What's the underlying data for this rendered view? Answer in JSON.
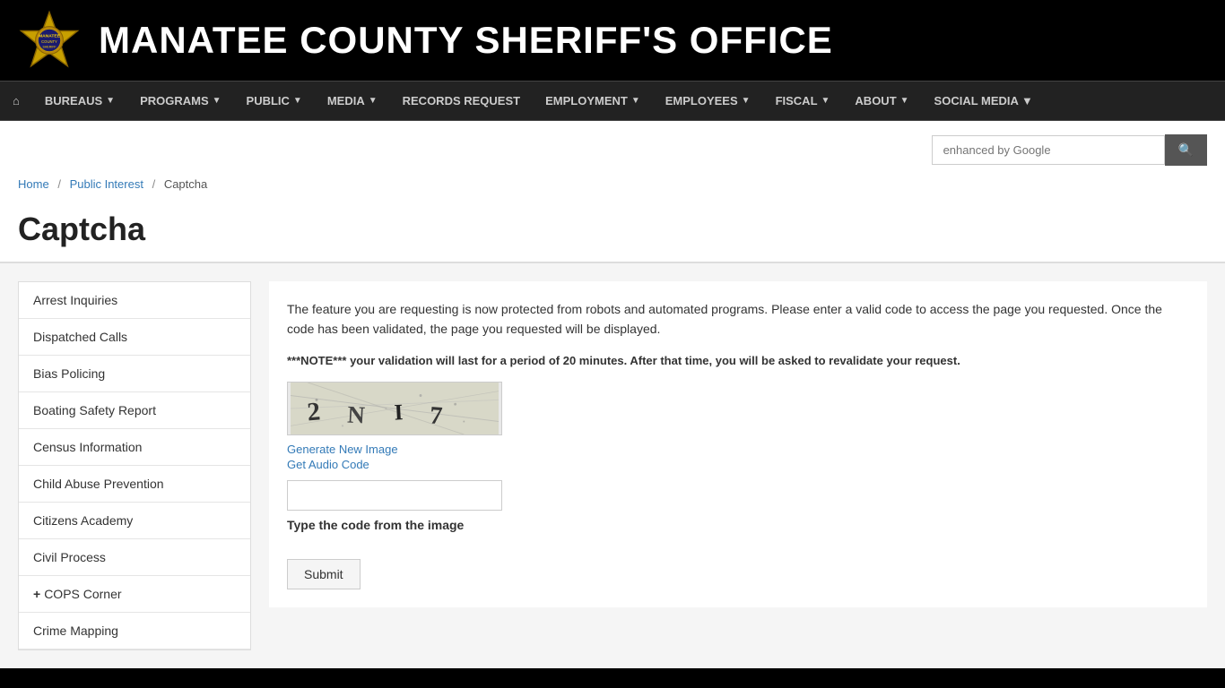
{
  "header": {
    "title": "MANATEE COUNTY SHERIFF'S OFFICE",
    "logo_alt": "Sheriff Badge"
  },
  "nav": {
    "home_label": "🏠",
    "items": [
      {
        "label": "BUREAUS",
        "has_dropdown": true
      },
      {
        "label": "PROGRAMS",
        "has_dropdown": true
      },
      {
        "label": "PUBLIC",
        "has_dropdown": true
      },
      {
        "label": "MEDIA",
        "has_dropdown": true
      },
      {
        "label": "RECORDS REQUEST",
        "has_dropdown": false
      },
      {
        "label": "EMPLOYMENT",
        "has_dropdown": true
      },
      {
        "label": "EMPLOYEES",
        "has_dropdown": true
      },
      {
        "label": "FISCAL",
        "has_dropdown": true
      },
      {
        "label": "ABOUT",
        "has_dropdown": true
      },
      {
        "label": "Social Media ▼",
        "has_dropdown": false
      }
    ]
  },
  "search": {
    "placeholder": "enhanced by Google",
    "button_label": "🔍"
  },
  "breadcrumb": {
    "home": "Home",
    "section": "Public Interest",
    "current": "Captcha"
  },
  "page": {
    "title": "Captcha"
  },
  "sidebar": {
    "items": [
      {
        "label": "Arrest Inquiries",
        "prefix": ""
      },
      {
        "label": "Dispatched Calls",
        "prefix": ""
      },
      {
        "label": "Bias Policing",
        "prefix": ""
      },
      {
        "label": "Boating Safety Report",
        "prefix": ""
      },
      {
        "label": "Census Information",
        "prefix": ""
      },
      {
        "label": "Child Abuse Prevention",
        "prefix": ""
      },
      {
        "label": "Citizens Academy",
        "prefix": ""
      },
      {
        "label": "Civil Process",
        "prefix": ""
      },
      {
        "label": "COPS Corner",
        "prefix": "+"
      },
      {
        "label": "Crime Mapping",
        "prefix": ""
      }
    ]
  },
  "captcha": {
    "description": "The feature you are requesting is now protected from robots and automated programs. Please enter a valid code to access the page you requested. Once the code has been validated, the page you requested will be displayed.",
    "note": "***NOTE*** your validation will last for a period of 20 minutes. After that time, you will be asked to revalidate your request.",
    "generate_link": "Generate New Image",
    "audio_link": "Get Audio Code",
    "input_placeholder": "",
    "input_label": "Type the code from the image",
    "submit_label": "Submit"
  }
}
